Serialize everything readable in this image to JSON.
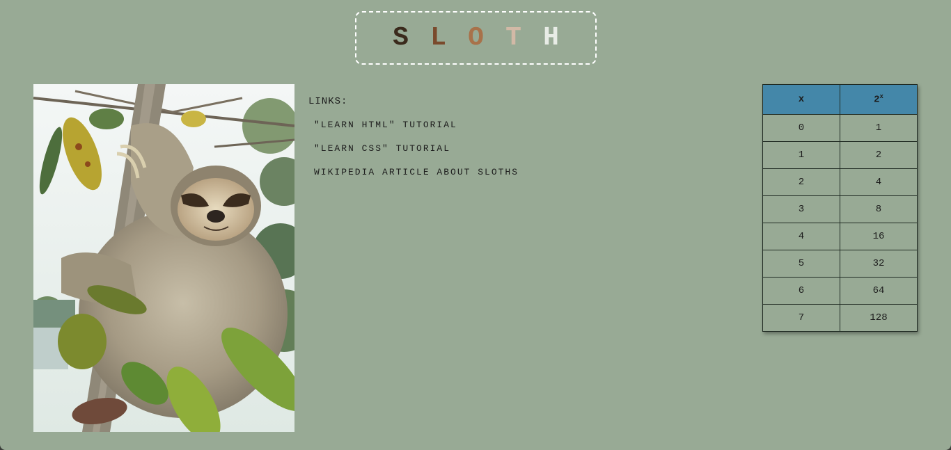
{
  "title": {
    "letters": [
      {
        "char": "S",
        "color": "#3a2a1c"
      },
      {
        "char": "L",
        "color": "#7a4a2c"
      },
      {
        "char": "O",
        "color": "#a8724a"
      },
      {
        "char": "T",
        "color": "#d2b9a6"
      },
      {
        "char": "H",
        "color": "#e8ece6"
      }
    ]
  },
  "colors": {
    "page_background": "#98aa95",
    "table_header": "#4487a9",
    "title_border": "#ffffff"
  },
  "photo": {
    "subject": "sloth hanging on tree"
  },
  "links": {
    "heading": "LINKS:",
    "items": [
      {
        "label": "\"LEARN HTML\" TUTORIAL"
      },
      {
        "label": "\"LEARN CSS\" TUTORIAL"
      },
      {
        "label": "WIKIPEDIA ARTICLE ABOUT SLOTHS"
      }
    ]
  },
  "table": {
    "header_x": "x",
    "header_base": "2",
    "header_exp": "x",
    "rows": [
      {
        "x": "0",
        "value": "1"
      },
      {
        "x": "1",
        "value": "2"
      },
      {
        "x": "2",
        "value": "4"
      },
      {
        "x": "3",
        "value": "8"
      },
      {
        "x": "4",
        "value": "16"
      },
      {
        "x": "5",
        "value": "32"
      },
      {
        "x": "6",
        "value": "64"
      },
      {
        "x": "7",
        "value": "128"
      }
    ]
  }
}
